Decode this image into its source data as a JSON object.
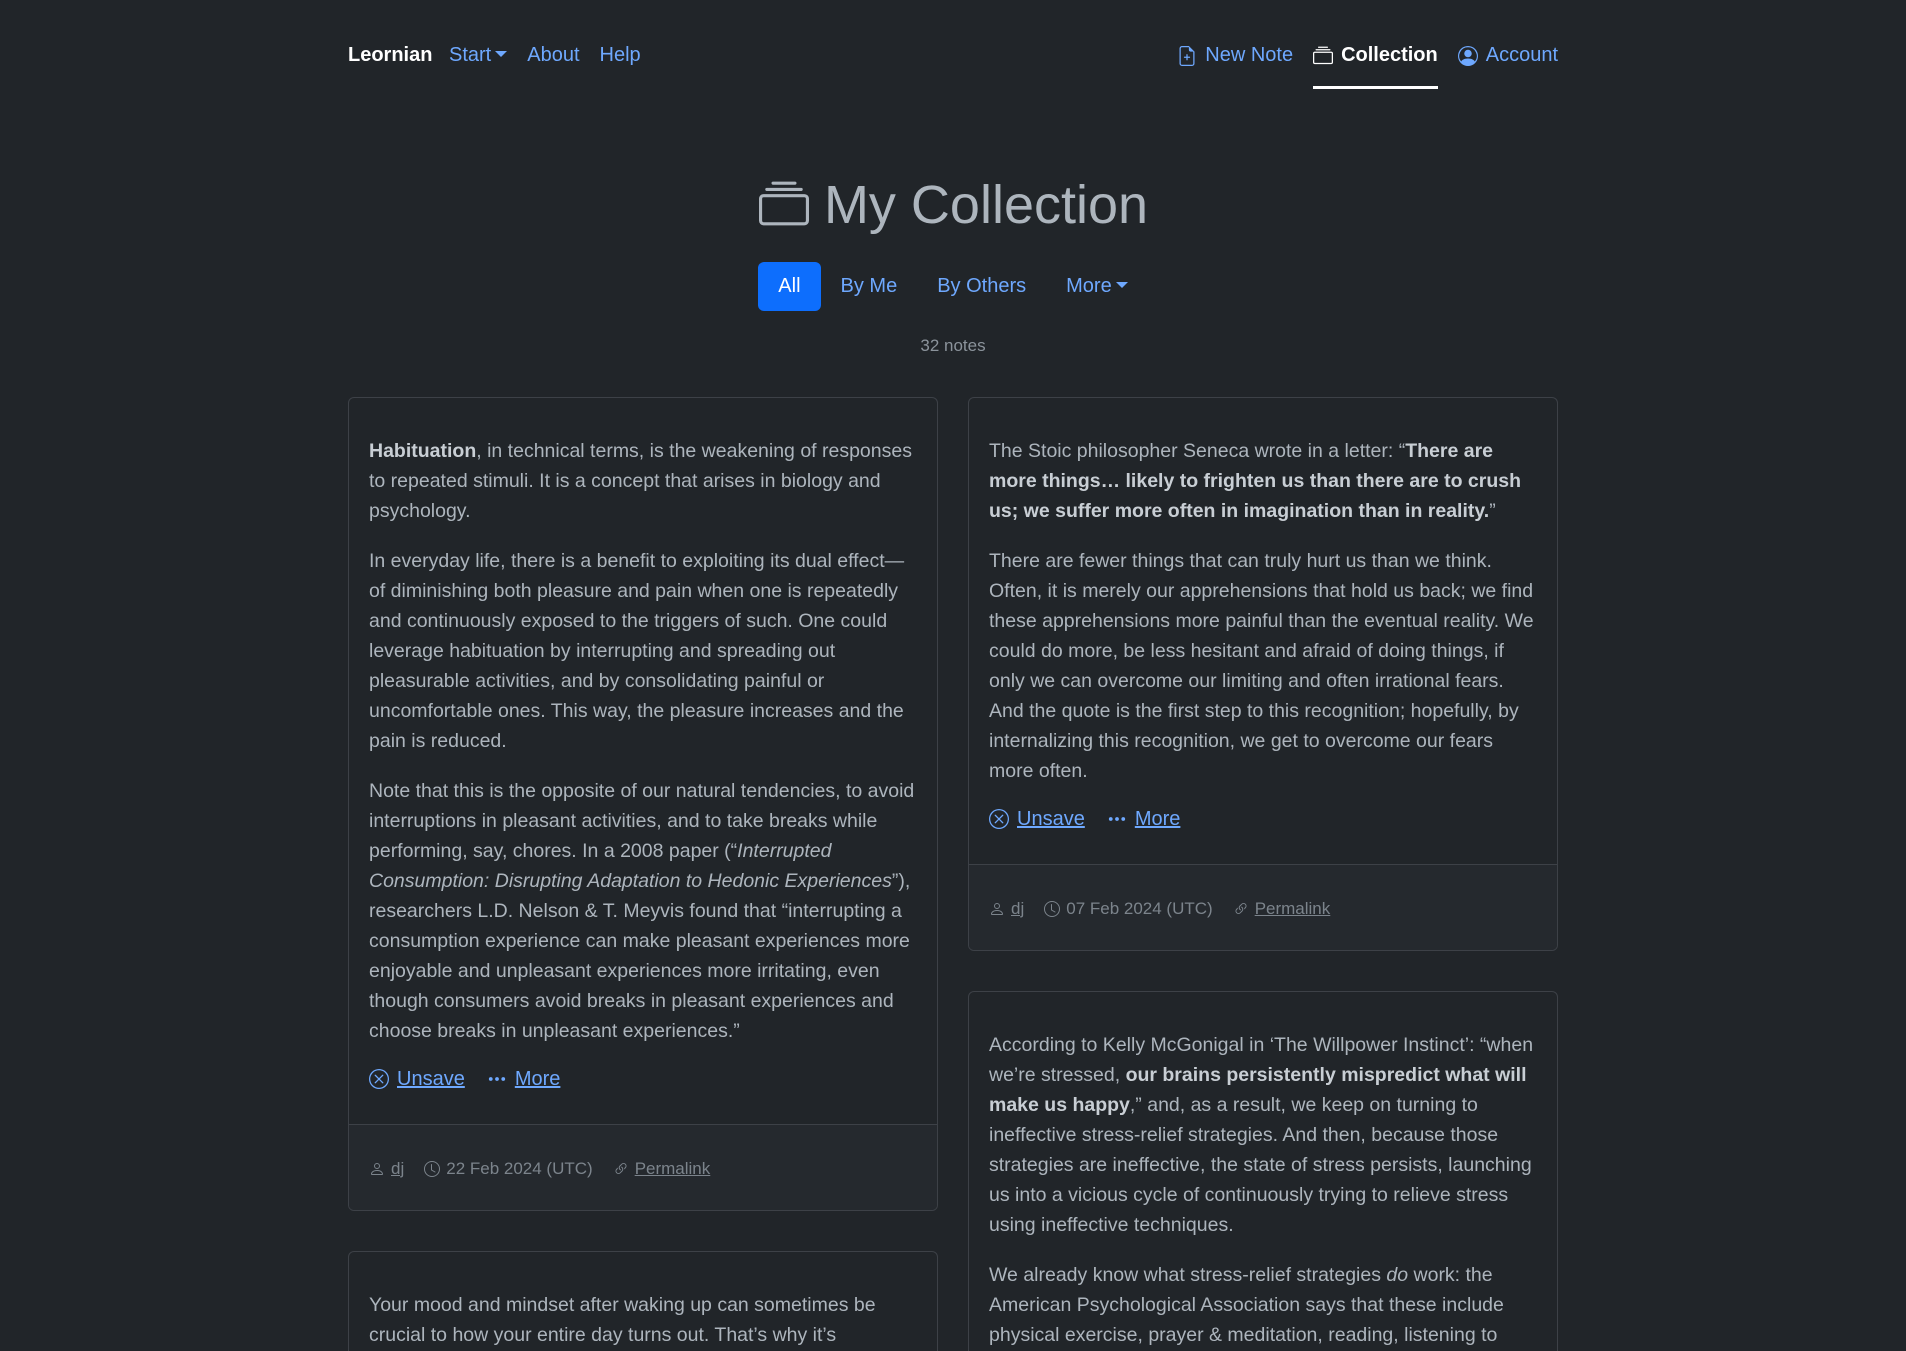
{
  "nav": {
    "brand": "Leornian",
    "left": [
      {
        "label": "Start"
      },
      {
        "label": "About"
      },
      {
        "label": "Help"
      }
    ],
    "right": {
      "new_note": "New Note",
      "collection": "Collection",
      "account": "Account"
    }
  },
  "page": {
    "title": "My Collection",
    "tabs": [
      "All",
      "By Me",
      "By Others",
      "More"
    ],
    "note_count": "32 notes"
  },
  "cards": [
    {
      "p1_bold": "Habituation",
      "p1_rest": ", in technical terms, is the weakening of responses to repeated stimuli. It is a concept that arises in biology and psychology.",
      "p2": "In everyday life, there is a benefit to exploiting its dual effect—of diminishing both pleasure and pain when one is repeatedly and continuously exposed to the triggers of such. One could leverage habituation by interrupting and spreading out pleasurable activities, and by consolidating painful or uncomfortable ones. This way, the pleasure increases and the pain is reduced.",
      "p3_a": "Note that this is the opposite of our natural tendencies, to avoid interruptions in pleasant activities, and to take breaks while performing, say, chores. In a 2008 paper (“",
      "p3_italic": "Interrupted Consumption: Disrupting Adaptation to Hedonic Experiences",
      "p3_b": "”), researchers L.D. Nelson & T. Meyvis found that “interrupting a consumption experience can make pleasant experiences more enjoyable and unpleasant experiences more irritating, even though consumers avoid breaks in pleasant experiences and choose breaks in unpleasant experiences.”",
      "unsave": "Unsave",
      "more": "More",
      "author": "dj",
      "date": "22 Feb 2024 (UTC)",
      "permalink": "Permalink"
    },
    {
      "p1_a": "The Stoic philosopher Seneca wrote in a letter: “",
      "p1_bold": "There are more things… likely to frighten us than there are to crush us; we suffer more often in imagination than in reality.",
      "p1_b": "”",
      "p2": "There are fewer things that can truly hurt us than we think. Often, it is merely our apprehensions that hold us back; we find these apprehensions more painful than the eventual reality. We could do more, be less hesitant and afraid of doing things, if only we can overcome our limiting and often irrational fears. And the quote is the first step to this recognition; hopefully, by internalizing this recognition, we get to overcome our fears more often.",
      "unsave": "Unsave",
      "more": "More",
      "author": "dj",
      "date": "07 Feb 2024 (UTC)",
      "permalink": "Permalink"
    },
    {
      "p1_a": "According to Kelly McGonigal in ‘The Willpower Instinct’: “when we’re stressed, ",
      "p1_bold": "our brains persistently mispredict what will make us happy",
      "p1_b": ",” and, as a result, we keep on turning to ineffective stress-relief strategies. And then, because those strategies are ineffective, the state of stress persists, launching us into a vicious cycle of continuously trying to relieve stress using ineffective techniques.",
      "p2_a": "We already know what stress-relief strategies ",
      "p2_italic": "do",
      "p2_b": " work: the American Psychological Association says that these include physical exercise, prayer & meditation, reading, listening to"
    },
    {
      "p1": "Your mood and mindset after waking up can sometimes be crucial to how your entire day turns out. That’s why it’s"
    }
  ]
}
